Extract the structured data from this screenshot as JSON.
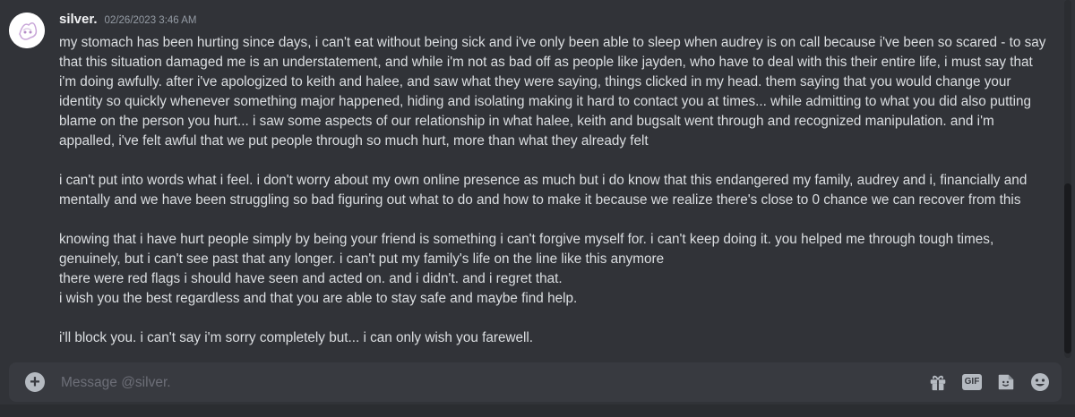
{
  "message": {
    "username": "silver.",
    "timestamp": "02/26/2023 3:46 AM",
    "paragraphs": [
      "my stomach has been hurting since days, i can't eat without being sick and i've only been able to sleep when audrey is on call because i've been so scared - to say that this situation damaged me is an understatement, and while i'm not as bad off as people like jayden, who have to deal with this their entire life, i must say that i'm doing awfully. after i've apologized to keith and halee, and saw what they were saying, things clicked in my head. them saying that you would change your identity so quickly whenever something major happened, hiding and isolating making it hard to contact you at times... while admitting to what you did also putting blame on the person you hurt... i saw some aspects of our relationship in what halee, keith and bugsalt went through and recognized manipulation. and i'm appalled, i've felt awful that we put people through so much hurt, more than what they already felt",
      "",
      "i can't put into words what i feel. i don't worry about my own online presence as much but i do know that this endangered my family, audrey and i, financially and mentally and we have been struggling so bad figuring out what to do and how to make it because we realize there's close to 0 chance we can recover from this",
      "",
      "knowing that i have hurt people simply by being your friend is something i can't forgive myself for. i can't keep doing it. you helped me through tough times, genuinely, but i can't see past that any longer. i can't put my family's life on the line like this anymore\nthere were red flags i should have seen and acted on. and i didn't. and i regret that.\ni wish you the best regardless and that you are able to stay safe and maybe find help.",
      "",
      "i'll block you. i can't say i'm sorry completely but... i can only wish you farewell."
    ]
  },
  "composer": {
    "placeholder": "Message @silver.",
    "gif_label": "GIF"
  },
  "icons": [
    "add-icon",
    "gift-icon",
    "gif-icon",
    "sticker-icon",
    "emoji-icon"
  ],
  "colors": {
    "background": "#313338",
    "composer": "#383a40",
    "text": "#dbdee1",
    "muted": "#949ba4"
  }
}
